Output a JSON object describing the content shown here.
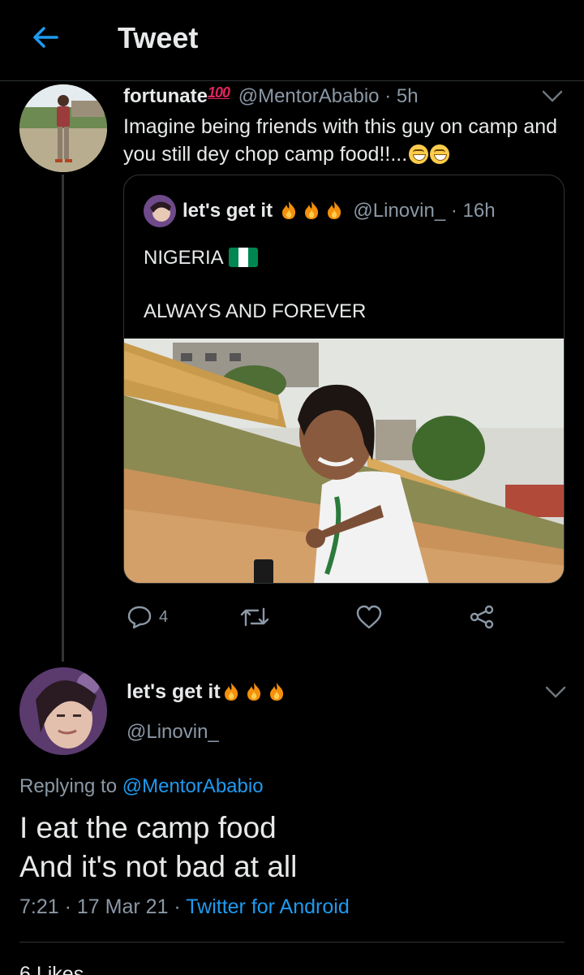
{
  "header": {
    "title": "Tweet"
  },
  "tweet": {
    "name": "fortunate",
    "name_badge": "100",
    "handle": "@MentorAbabio",
    "sep": "·",
    "time": "5h",
    "text": "Imagine being friends with this guy on camp and you still dey chop camp food!!...",
    "quoted": {
      "name": "let's get it",
      "handle": "@Linovin_",
      "sep": "·",
      "time": "16h",
      "line1": "NIGERIA",
      "line2": "ALWAYS AND FOREVER"
    },
    "actions": {
      "reply_count": "4"
    }
  },
  "reply": {
    "name": "let's get it",
    "handle": "@Linovin_",
    "replying_prefix": "Replying to",
    "replying_handle": "@MentorAbabio",
    "line1": "I eat the camp food",
    "line2": "And it's not bad at all",
    "time": "7:21",
    "date": "17 Mar 21",
    "sep": "·",
    "source": "Twitter for Android",
    "likes": "6 Likes"
  },
  "colors": {
    "accent": "#1d9bf0",
    "background": "#000000",
    "muted": "#8b98a5",
    "border": "#2f3336"
  },
  "icons": [
    "back-arrow-icon",
    "chevron-down-icon",
    "reply-icon",
    "retweet-icon",
    "like-icon",
    "share-icon",
    "fire-emoji-icon",
    "grinning-emoji-icon",
    "nigeria-flag-icon"
  ]
}
